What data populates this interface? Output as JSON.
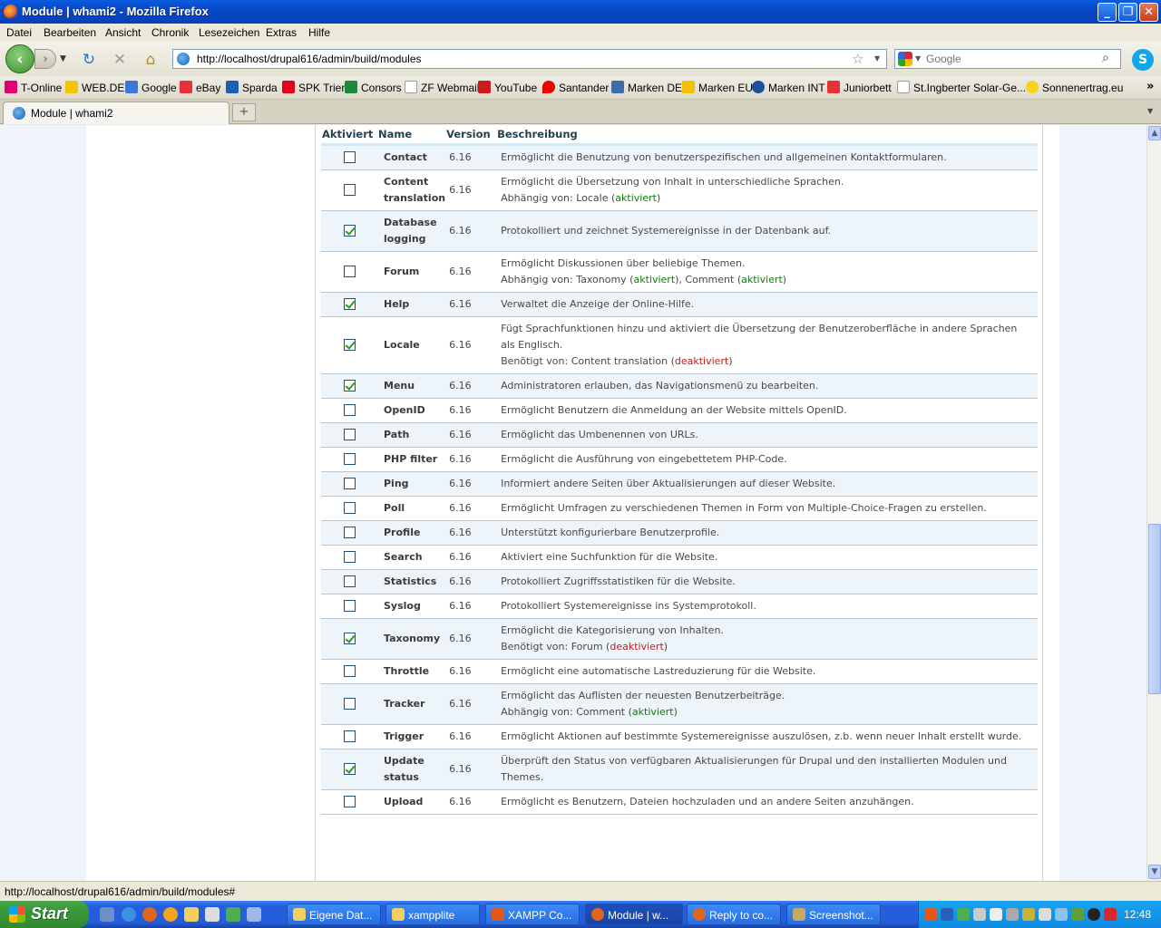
{
  "window": {
    "title": "Module | whami2 - Mozilla Firefox"
  },
  "menu": [
    "Datei",
    "Bearbeiten",
    "Ansicht",
    "Chronik",
    "Lesezeichen",
    "Extras",
    "Hilfe"
  ],
  "nav": {
    "url": "http://localhost/drupal616/admin/build/modules",
    "search_placeholder": "Google"
  },
  "bookmarks": [
    "T-Online",
    "WEB.DE",
    "Google",
    "eBay",
    "Sparda",
    "SPK Trier",
    "Consors",
    "ZF Webmail",
    "YouTube",
    "Santander",
    "Marken DE",
    "Marken EU",
    "Marken INT",
    "Juniorbett",
    "St.Ingberter Solar-Ge...",
    "Sonnenertrag.eu"
  ],
  "tab": {
    "label": "Module | whami2"
  },
  "table": {
    "headers": [
      "Aktiviert",
      "Name",
      "Version",
      "Beschreibung"
    ],
    "rows": [
      {
        "checked": false,
        "name": "Contact",
        "version": "6.16",
        "desc": "Ermöglicht die Benutzung von benutzerspezifischen und allgemeinen Kontaktformularen."
      },
      {
        "checked": false,
        "name": "Content translation",
        "version": "6.16",
        "desc": "Ermöglicht die Übersetzung von Inhalt in unterschiedliche Sprachen.",
        "dep_prefix": "Abhängig von: ",
        "deps": [
          {
            "t": "Locale ("
          },
          {
            "t": "aktiviert",
            "s": "en"
          },
          {
            "t": ")"
          }
        ]
      },
      {
        "checked": true,
        "name": "Database logging",
        "version": "6.16",
        "desc": "Protokolliert und zeichnet Systemereignisse in der Datenbank auf."
      },
      {
        "checked": false,
        "name": "Forum",
        "version": "6.16",
        "desc": "Ermöglicht Diskussionen über beliebige Themen.",
        "dep_prefix": "Abhängig von: ",
        "deps": [
          {
            "t": "Taxonomy ("
          },
          {
            "t": "aktiviert",
            "s": "en"
          },
          {
            "t": "), Comment ("
          },
          {
            "t": "aktiviert",
            "s": "en"
          },
          {
            "t": ")"
          }
        ]
      },
      {
        "checked": true,
        "name": "Help",
        "version": "6.16",
        "desc": "Verwaltet die Anzeige der Online-Hilfe."
      },
      {
        "checked": true,
        "name": "Locale",
        "version": "6.16",
        "desc": "Fügt Sprachfunktionen hinzu und aktiviert die Übersetzung der Benutzeroberfläche in andere Sprachen als Englisch.",
        "dep_prefix": "Benötigt von: ",
        "deps": [
          {
            "t": "Content translation ("
          },
          {
            "t": "deaktiviert",
            "s": "dis"
          },
          {
            "t": ")"
          }
        ]
      },
      {
        "checked": true,
        "name": "Menu",
        "version": "6.16",
        "desc": "Administratoren erlauben, das Navigationsmenü zu bearbeiten."
      },
      {
        "checked": false,
        "name": "OpenID",
        "version": "6.16",
        "desc": "Ermöglicht Benutzern die Anmeldung an der Website mittels OpenID."
      },
      {
        "checked": false,
        "name": "Path",
        "version": "6.16",
        "desc": "Ermöglicht das Umbenennen von URLs."
      },
      {
        "checked": false,
        "name": "PHP filter",
        "version": "6.16",
        "desc": "Ermöglicht die Ausführung von eingebettetem PHP-Code."
      },
      {
        "checked": false,
        "name": "Ping",
        "version": "6.16",
        "desc": "Informiert andere Seiten über Aktualisierungen auf dieser Website."
      },
      {
        "checked": false,
        "name": "Poll",
        "version": "6.16",
        "desc": "Ermöglicht Umfragen zu verschiedenen Themen in Form von Multiple-Choice-Fragen zu erstellen."
      },
      {
        "checked": false,
        "name": "Profile",
        "version": "6.16",
        "desc": "Unterstützt konfigurierbare Benutzerprofile."
      },
      {
        "checked": false,
        "name": "Search",
        "version": "6.16",
        "desc": "Aktiviert eine Suchfunktion für die Website."
      },
      {
        "checked": false,
        "name": "Statistics",
        "version": "6.16",
        "desc": "Protokolliert Zugriffsstatistiken für die Website."
      },
      {
        "checked": false,
        "name": "Syslog",
        "version": "6.16",
        "desc": "Protokolliert Systemereignisse ins Systemprotokoll."
      },
      {
        "checked": true,
        "name": "Taxonomy",
        "version": "6.16",
        "desc": "Ermöglicht die Kategorisierung von Inhalten.",
        "dep_prefix": "Benötigt von: ",
        "deps": [
          {
            "t": "Forum ("
          },
          {
            "t": "deaktiviert",
            "s": "dis"
          },
          {
            "t": ")"
          }
        ]
      },
      {
        "checked": false,
        "name": "Throttle",
        "version": "6.16",
        "desc": "Ermöglicht eine automatische Lastreduzierung für die Website."
      },
      {
        "checked": false,
        "name": "Tracker",
        "version": "6.16",
        "desc": "Ermöglicht das Auflisten der neuesten Benutzerbeiträge.",
        "dep_prefix": "Abhängig von: ",
        "deps": [
          {
            "t": "Comment ("
          },
          {
            "t": "aktiviert",
            "s": "en"
          },
          {
            "t": ")"
          }
        ]
      },
      {
        "checked": false,
        "name": "Trigger",
        "version": "6.16",
        "desc": "Ermöglicht Aktionen auf bestimmte Systemereignisse auszulösen, z.b. wenn neuer Inhalt erstellt wurde."
      },
      {
        "checked": true,
        "name": "Update status",
        "version": "6.16",
        "desc": "Überprüft den Status von verfügbaren Aktualisierungen für Drupal und den installierten Modulen und Themes."
      },
      {
        "checked": false,
        "name": "Upload",
        "version": "6.16",
        "desc": "Ermöglicht es Benutzern, Dateien hochzuladen und an andere Seiten anzuhängen."
      }
    ]
  },
  "status": {
    "text": "http://localhost/drupal616/admin/build/modules#"
  },
  "taskbar": {
    "start": "Start",
    "items": [
      "Eigene Dat...",
      "xampplite",
      "XAMPP Co...",
      "Module | w...",
      "Reply to co...",
      "Screenshot..."
    ],
    "clock": "12:48"
  }
}
